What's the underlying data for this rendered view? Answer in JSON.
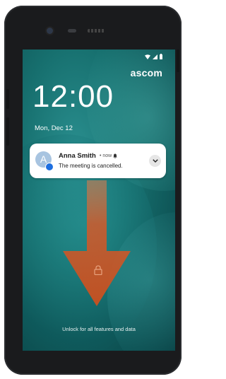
{
  "lockscreen": {
    "brand": "ascom",
    "time": "12:00",
    "date": "Mon, Dec 12",
    "unlock_hint": "Unlock for all features and data"
  },
  "status_bar": {
    "icons": [
      "wifi-icon",
      "signal-icon",
      "battery-icon"
    ]
  },
  "notification": {
    "avatar_initial": "A",
    "sender": "Anna Smith",
    "meta": "• now",
    "message": "The meeting is cancelled.",
    "expand_icon": "chevron-down-icon"
  },
  "overlay": {
    "gesture": "swipe-down-arrow",
    "color": "#d35a2a"
  },
  "colors": {
    "device": "#1a1b1d",
    "screen_teal": "#17706f",
    "avatar": "#a8c4e0",
    "badge": "#1e6fe0"
  }
}
